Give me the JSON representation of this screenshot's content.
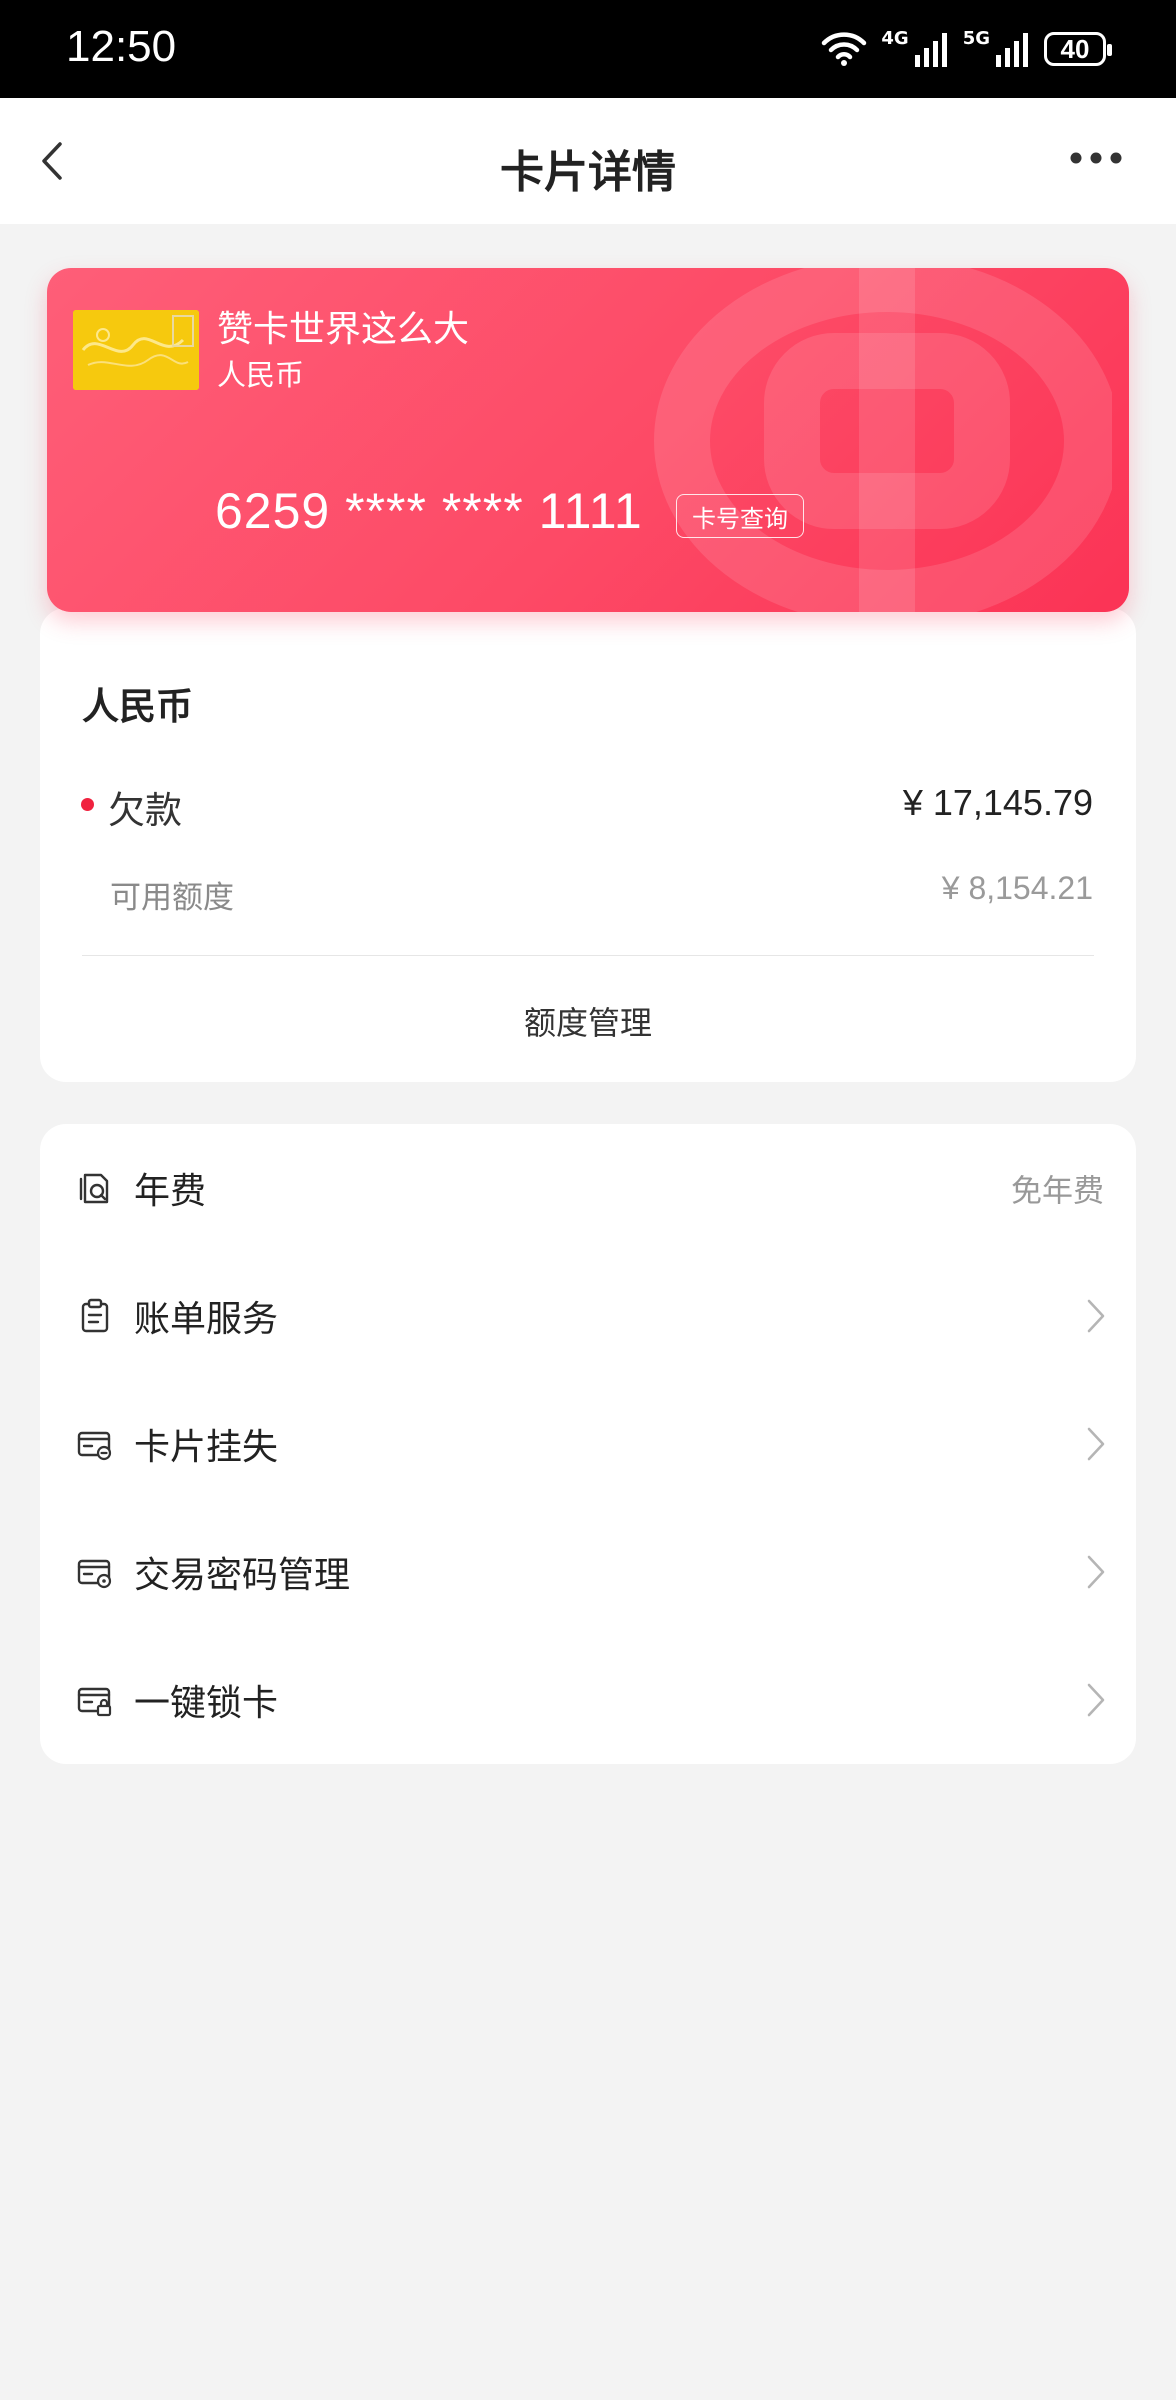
{
  "status_bar": {
    "time": "12:50",
    "net1": "4G",
    "net2": "5G",
    "battery": "40"
  },
  "header": {
    "title": "卡片详情"
  },
  "card": {
    "name": "赞卡世界这么大",
    "currency": "人民币",
    "number": "6259 **** **** 1111",
    "query_button": "卡号查询",
    "brand_color": "#fd4a66"
  },
  "balance": {
    "title": "人民币",
    "debt_label": "欠款",
    "debt_value": "¥ 17,145.79",
    "available_label": "可用额度",
    "available_value": "¥ 8,154.21",
    "limit_management": "额度管理",
    "debt_dot_color": "#f0223f"
  },
  "menu": {
    "items": [
      {
        "label": "年费",
        "value": "免年费",
        "icon": "annual-fee-icon"
      },
      {
        "label": "账单服务",
        "icon": "bill-icon"
      },
      {
        "label": "卡片挂失",
        "icon": "card-loss-icon"
      },
      {
        "label": "交易密码管理",
        "icon": "card-password-icon"
      },
      {
        "label": "一键锁卡",
        "icon": "card-lock-icon"
      }
    ]
  }
}
